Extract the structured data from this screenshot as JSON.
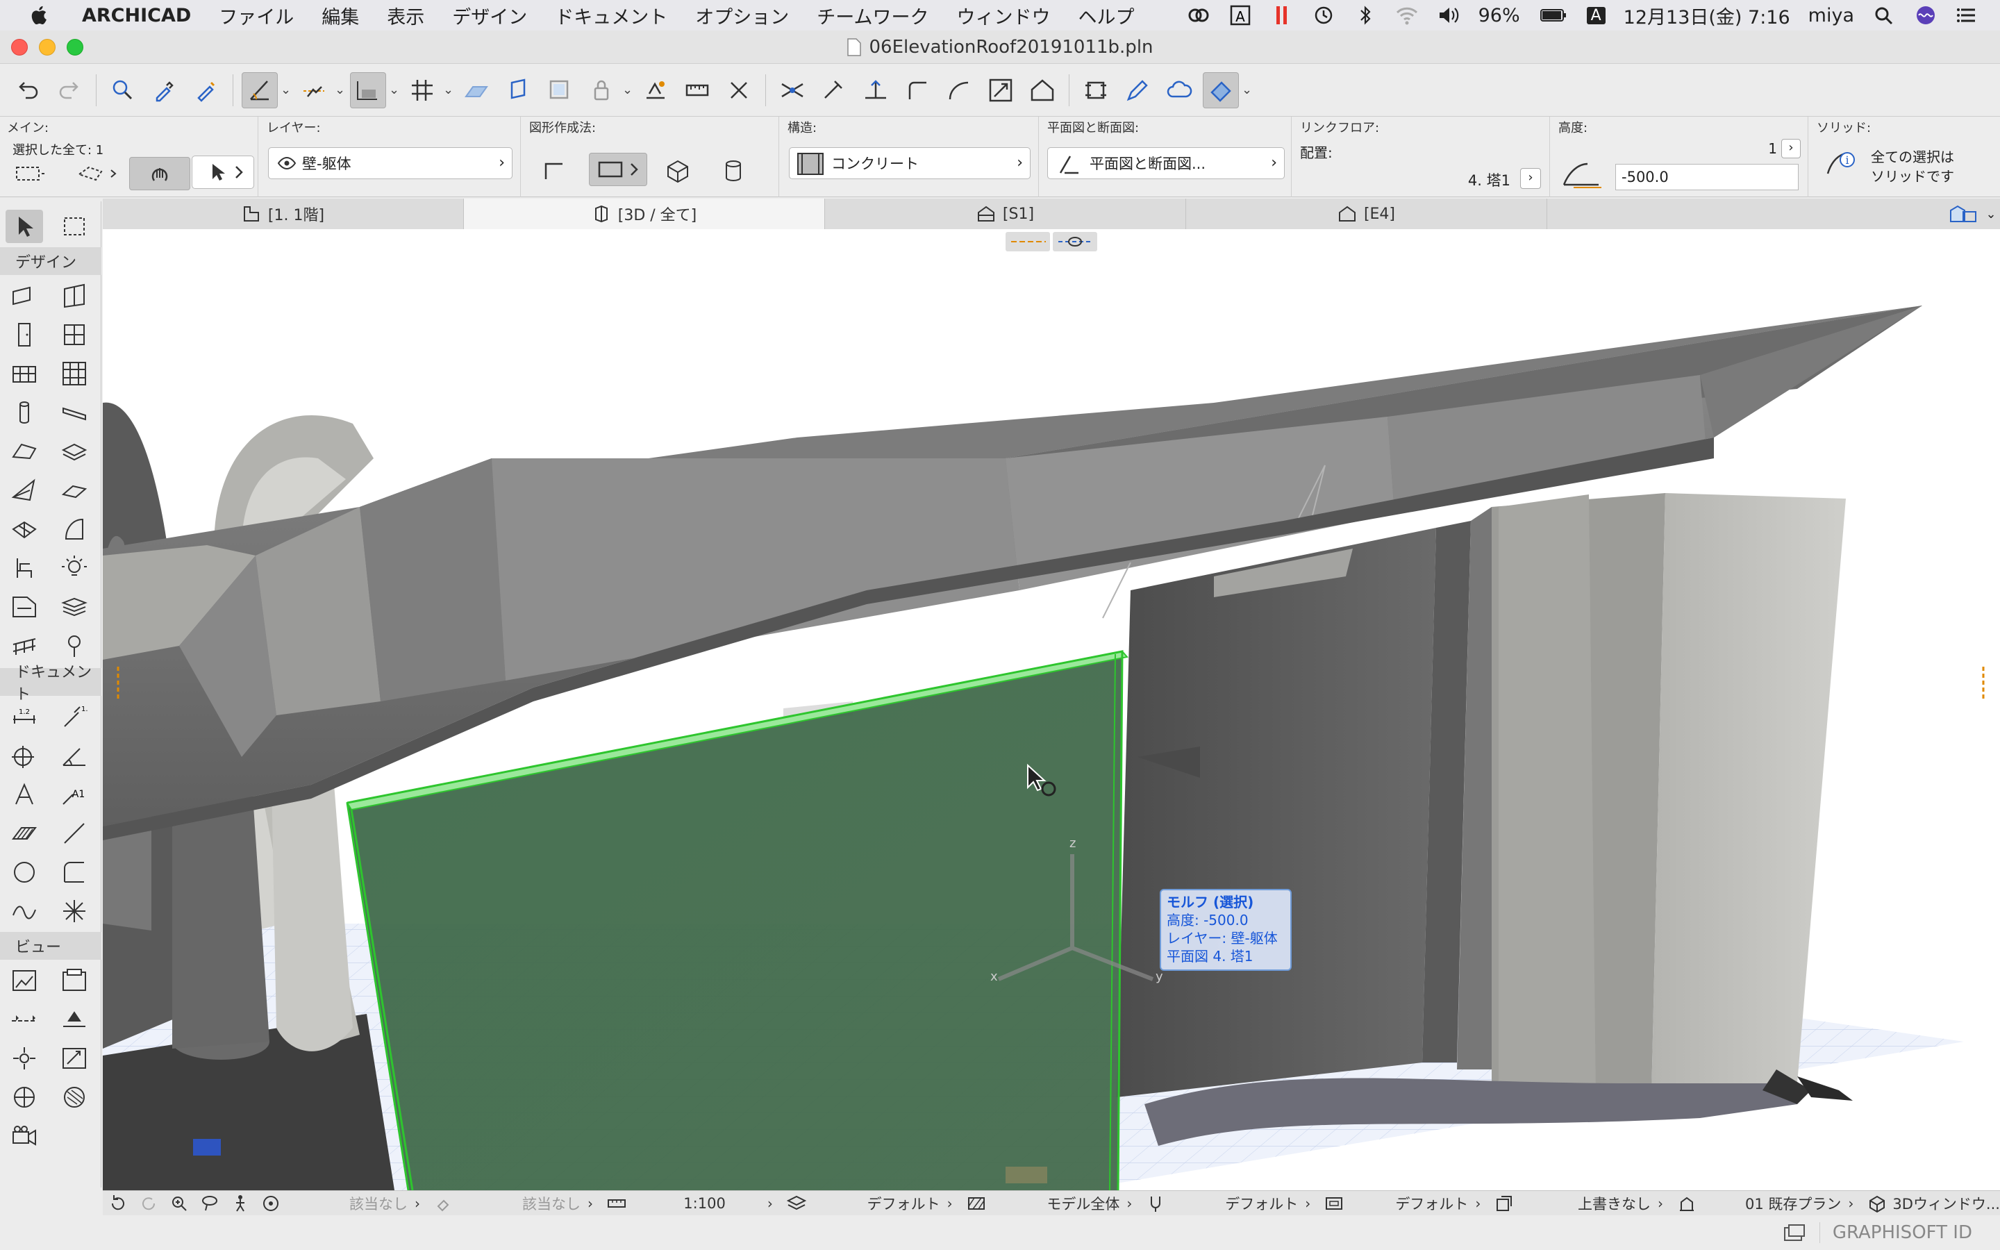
{
  "menubar": {
    "app": "ARCHICAD",
    "items": [
      "ファイル",
      "編集",
      "表示",
      "デザイン",
      "ドキュメント",
      "オプション",
      "チームワーク",
      "ウィンドウ",
      "ヘルプ"
    ],
    "battery": "96%",
    "clock": "12月13日(金) 7:16",
    "user": "miya",
    "input_indicator": "A"
  },
  "window": {
    "title": "06ElevationRoof20191011b.pln"
  },
  "infobox": {
    "main_caption": "メイン:",
    "selected_text": "選択した全て: 1",
    "layer_caption": "レイヤー:",
    "layer_value": "壁-躯体",
    "geometry_caption": "図形作成法:",
    "structure_caption": "構造:",
    "structure_value": "コンクリート",
    "plan_section_caption": "平面図と断面図:",
    "plan_section_value": "平面図と断面図...",
    "link_floor_caption": "リンクフロア:",
    "placement_label": "配置:",
    "placement_value": "4. 塔1",
    "height_caption": "高度:",
    "height_index": "1",
    "height_value": "-500.0",
    "solid_caption": "ソリッド:",
    "solid_line1": "全ての選択は",
    "solid_line2": "ソリッドです"
  },
  "tabs": [
    {
      "label": "[1. 1階]"
    },
    {
      "label": "[3D / 全て]"
    },
    {
      "label": "[S1]"
    },
    {
      "label": "[E4]"
    }
  ],
  "toolbox": {
    "design_label": "デザイン",
    "document_label": "ドキュメント",
    "view_label": "ビュー"
  },
  "tooltip": {
    "title": "モルフ (選択)",
    "height": "高度: -500.0",
    "layer": "レイヤー: 壁-躯体",
    "plan": "平面図 4. 塔1"
  },
  "axes": {
    "x": "x",
    "y": "y",
    "z": "z"
  },
  "statusbar": {
    "undo_na": "該当なし",
    "redo_na": "該当なし",
    "scale": "1:100",
    "layer_combo": "デフォルト",
    "model_view": "モデル全体",
    "pen_set": "デフォルト",
    "dimension": "デフォルト",
    "override": "上書きなし",
    "renovation": "01 既存プラン",
    "window_3d": "3Dウィンドウ..."
  },
  "footer": {
    "brand": "GRAPHISOFT ID"
  },
  "colors": {
    "selection": "#2ec52e",
    "morph_fill": "#3f6548",
    "highlight": "#1756d8"
  }
}
